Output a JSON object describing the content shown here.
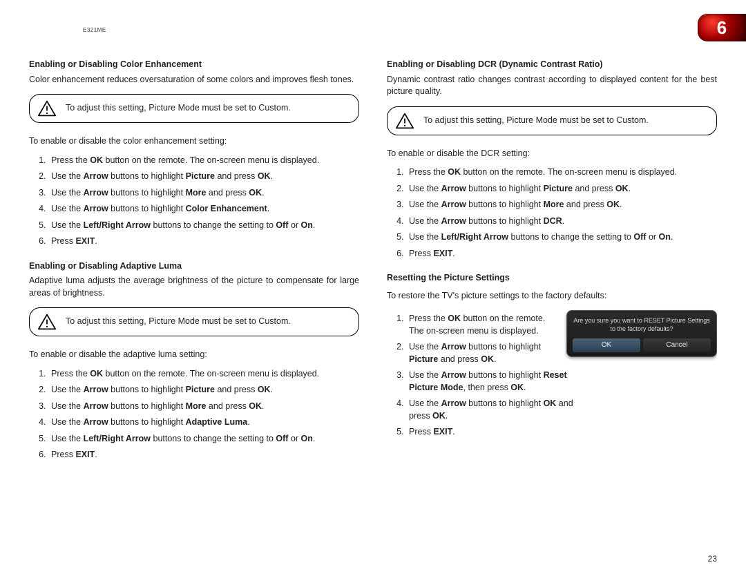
{
  "model": "E321ME",
  "chapter_number": "6",
  "page_number": "23",
  "note_text": "To adjust this setting, Picture Mode must be set to Custom.",
  "left": {
    "s1": {
      "heading": "Enabling or Disabling Color Enhancement",
      "intro": "Color enhancement reduces oversaturation of some colors and improves flesh tones.",
      "lead": "To enable or disable the color enhancement setting:",
      "steps": {
        "a": {
          "pre": "Press the ",
          "b1": "OK",
          "post": " button on the remote. The on-screen menu is displayed."
        },
        "b": {
          "pre": "Use the ",
          "b1": "Arrow",
          "mid": " buttons to highlight ",
          "b2": "Picture",
          "mid2": " and press ",
          "b3": "OK",
          "post": "."
        },
        "c": {
          "pre": "Use the ",
          "b1": "Arrow",
          "mid": " buttons to highlight ",
          "b2": "More",
          "mid2": " and press ",
          "b3": "OK",
          "post": "."
        },
        "d": {
          "pre": "Use the ",
          "b1": "Arrow",
          "mid": " buttons to highlight ",
          "b2": "Color Enhancement",
          "post": "."
        },
        "e": {
          "pre": "Use the ",
          "b1": "Left/Right Arrow",
          "mid": " buttons to change the setting to ",
          "b2": "Off",
          "mid2": " or ",
          "b3": "On",
          "post": "."
        },
        "f": {
          "pre": "Press ",
          "b1": "EXIT",
          "post": "."
        }
      }
    },
    "s2": {
      "heading": "Enabling or Disabling Adaptive Luma",
      "intro": "Adaptive luma adjusts the average brightness of the picture to compensate for large areas of brightness.",
      "lead": "To enable or disable the adaptive luma setting:",
      "steps": {
        "a": {
          "pre": "Press the ",
          "b1": "OK",
          "post": " button on the remote. The on-screen menu is displayed."
        },
        "b": {
          "pre": "Use the ",
          "b1": "Arrow",
          "mid": " buttons to highlight ",
          "b2": "Picture",
          "mid2": " and press ",
          "b3": "OK",
          "post": "."
        },
        "c": {
          "pre": "Use the ",
          "b1": "Arrow",
          "mid": " buttons to highlight ",
          "b2": "More",
          "mid2": " and press ",
          "b3": "OK",
          "post": "."
        },
        "d": {
          "pre": "Use the ",
          "b1": "Arrow",
          "mid": " buttons to highlight ",
          "b2": "Adaptive Luma",
          "post": "."
        },
        "e": {
          "pre": "Use the ",
          "b1": "Left/Right Arrow",
          "mid": " buttons to change the setting to ",
          "b2": "Off",
          "mid2": " or ",
          "b3": "On",
          "post": "."
        },
        "f": {
          "pre": "Press ",
          "b1": "EXIT",
          "post": "."
        }
      }
    }
  },
  "right": {
    "s1": {
      "heading": "Enabling or Disabling DCR (Dynamic Contrast Ratio)",
      "intro": "Dynamic contrast ratio changes contrast according to displayed content for the best picture quality.",
      "lead": "To enable or disable the DCR setting:",
      "steps": {
        "a": {
          "pre": "Press the ",
          "b1": "OK",
          "post": " button on the remote. The on-screen menu is displayed."
        },
        "b": {
          "pre": "Use the ",
          "b1": "Arrow",
          "mid": " buttons to highlight ",
          "b2": "Picture",
          "mid2": " and press ",
          "b3": "OK",
          "post": "."
        },
        "c": {
          "pre": "Use the ",
          "b1": "Arrow",
          "mid": " buttons to highlight ",
          "b2": "More",
          "mid2": " and press ",
          "b3": "OK",
          "post": "."
        },
        "d": {
          "pre": "Use the ",
          "b1": "Arrow",
          "mid": " buttons to highlight ",
          "b2": "DCR",
          "post": "."
        },
        "e": {
          "pre": "Use the ",
          "b1": "Left/Right Arrow",
          "mid": " buttons to change the setting to ",
          "b2": "Off",
          "mid2": " or ",
          "b3": "On",
          "post": "."
        },
        "f": {
          "pre": "Press ",
          "b1": "EXIT",
          "post": "."
        }
      }
    },
    "s2": {
      "heading": "Resetting the Picture Settings",
      "intro": "To restore the TV's picture settings to the factory defaults:",
      "dialog": {
        "msg": "Are you sure you want to RESET Picture Settings to the factory defaults?",
        "ok": "OK",
        "cancel": "Cancel"
      },
      "steps": {
        "a": {
          "pre": "Press the ",
          "b1": "OK",
          "post": " button on the remote. The on-screen menu is displayed."
        },
        "b": {
          "pre": "Use the ",
          "b1": "Arrow",
          "mid": " buttons to highlight ",
          "b2": "Picture",
          "mid2": " and press ",
          "b3": "OK",
          "post": "."
        },
        "c": {
          "pre": "Use the ",
          "b1": "Arrow",
          "mid": " buttons to highlight ",
          "b2": "Reset Picture Mode",
          "mid2": ", then press ",
          "b3": "OK",
          "post": "."
        },
        "d": {
          "pre": "Use the ",
          "b1": "Arrow",
          "mid": " buttons to highlight ",
          "b2": "OK",
          "mid2": " and press ",
          "b3": "OK",
          "post": "."
        },
        "e": {
          "pre": "Press ",
          "b1": "EXIT",
          "post": "."
        }
      }
    }
  }
}
